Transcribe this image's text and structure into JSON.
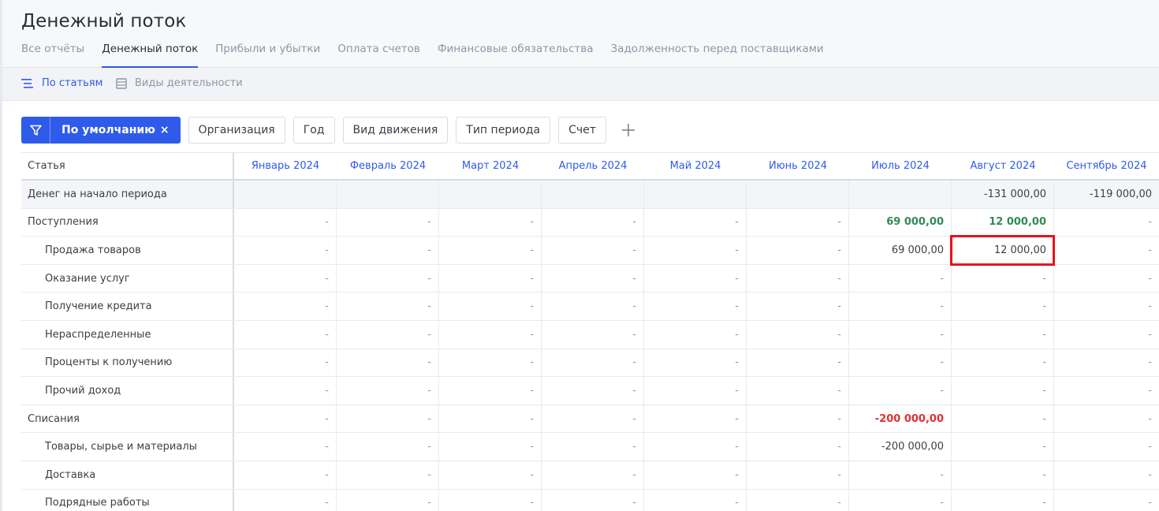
{
  "page": {
    "title": "Денежный поток"
  },
  "tabs": [
    {
      "label": "Все отчёты",
      "active": false
    },
    {
      "label": "Денежный поток",
      "active": true
    },
    {
      "label": "Прибыли и убытки",
      "active": false
    },
    {
      "label": "Оплата счетов",
      "active": false
    },
    {
      "label": "Финансовые обязательства",
      "active": false
    },
    {
      "label": "Задолженность перед поставщиками",
      "active": false
    }
  ],
  "view_modes": [
    {
      "label": "По статьям",
      "icon": "list-indent-icon",
      "active": true
    },
    {
      "label": "Виды деятельности",
      "icon": "table-icon",
      "active": false
    }
  ],
  "filters": {
    "preset_label": "По умолчанию",
    "preset_close": "×",
    "chips": [
      "Организация",
      "Год",
      "Вид движения",
      "Тип периода",
      "Счет"
    ],
    "add_icon": "plus-icon"
  },
  "table": {
    "first_column_header": "Статья",
    "months": [
      "Январь 2024",
      "Февраль 2024",
      "Март 2024",
      "Апрель 2024",
      "Май 2024",
      "Июнь 2024",
      "Июль 2024",
      "Август 2024",
      "Сентябрь 2024"
    ],
    "rows": [
      {
        "label": "Денег на начало периода",
        "type": "opening",
        "values": [
          "",
          "",
          "",
          "",
          "",
          "",
          "",
          "-131 000,00",
          "-119 000,00"
        ]
      },
      {
        "label": "Поступления",
        "type": "group",
        "values": [
          "-",
          "-",
          "-",
          "-",
          "-",
          "-",
          "69 000,00",
          "12 000,00",
          "-"
        ]
      },
      {
        "label": "Продажа товаров",
        "type": "item",
        "values": [
          "-",
          "-",
          "-",
          "-",
          "-",
          "-",
          "69 000,00",
          "12 000,00",
          "-"
        ]
      },
      {
        "label": "Оказание услуг",
        "type": "item",
        "values": [
          "-",
          "-",
          "-",
          "-",
          "-",
          "-",
          "-",
          "-",
          "-"
        ]
      },
      {
        "label": "Получение кредита",
        "type": "item",
        "values": [
          "-",
          "-",
          "-",
          "-",
          "-",
          "-",
          "-",
          "-",
          "-"
        ]
      },
      {
        "label": "Нераспределенные",
        "type": "item",
        "values": [
          "-",
          "-",
          "-",
          "-",
          "-",
          "-",
          "-",
          "-",
          "-"
        ]
      },
      {
        "label": "Проценты к получению",
        "type": "item",
        "values": [
          "-",
          "-",
          "-",
          "-",
          "-",
          "-",
          "-",
          "-",
          "-"
        ]
      },
      {
        "label": "Прочий доход",
        "type": "item",
        "values": [
          "-",
          "-",
          "-",
          "-",
          "-",
          "-",
          "-",
          "-",
          "-"
        ]
      },
      {
        "label": "Списания",
        "type": "group",
        "values": [
          "-",
          "-",
          "-",
          "-",
          "-",
          "-",
          "-200 000,00",
          "-",
          "-"
        ]
      },
      {
        "label": "Товары, сырье и материалы",
        "type": "item",
        "values": [
          "-",
          "-",
          "-",
          "-",
          "-",
          "-",
          "-200 000,00",
          "-",
          "-"
        ]
      },
      {
        "label": "Доставка",
        "type": "item",
        "values": [
          "-",
          "-",
          "-",
          "-",
          "-",
          "-",
          "-",
          "-",
          "-"
        ]
      },
      {
        "label": "Подрядные работы",
        "type": "item",
        "values": [
          "-",
          "-",
          "-",
          "-",
          "-",
          "-",
          "-",
          "-",
          "-"
        ]
      }
    ],
    "highlighted_cell": {
      "row": 2,
      "col": 7
    }
  },
  "colors": {
    "accent": "#2f5bea",
    "positive": "#2e8b57",
    "negative": "#e03131",
    "highlight_border": "#e8121b"
  }
}
